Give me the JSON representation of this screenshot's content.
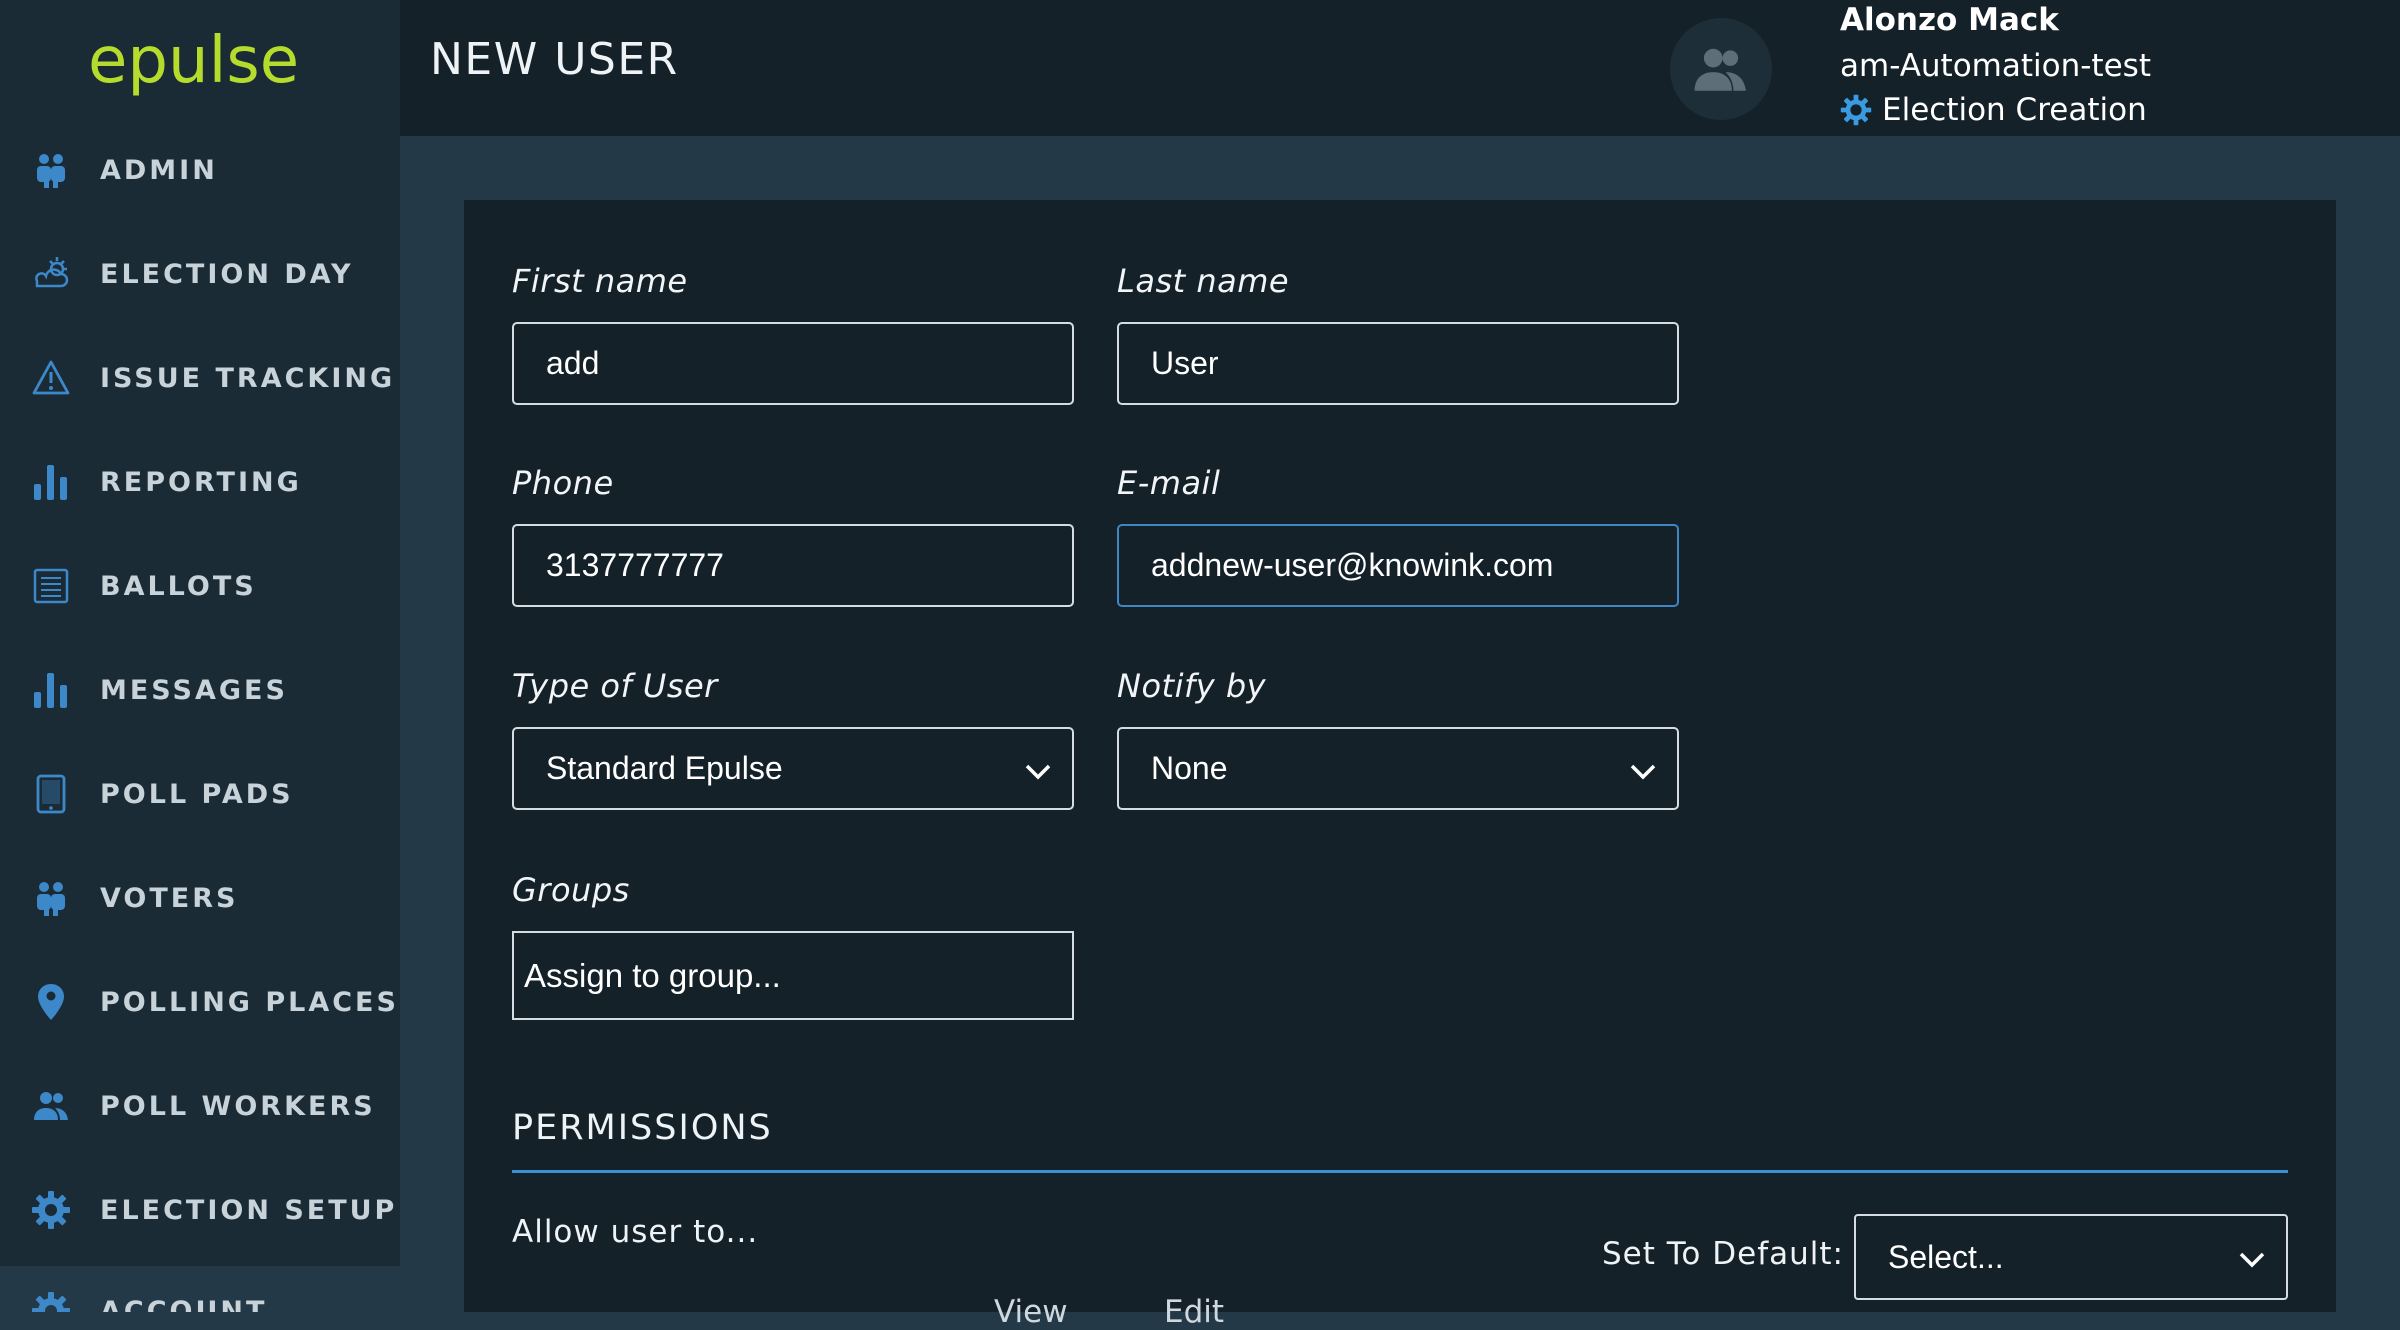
{
  "brand": {
    "logo_text": "epulse",
    "logo_color": "#b5dc2c"
  },
  "sidebar": {
    "items": [
      {
        "label": "ADMIN",
        "icon": "users-icon"
      },
      {
        "label": "ELECTION DAY",
        "icon": "cloud-sun-icon"
      },
      {
        "label": "ISSUE TRACKING",
        "icon": "warning-icon"
      },
      {
        "label": "REPORTING",
        "icon": "bar-chart-icon"
      },
      {
        "label": "BALLOTS",
        "icon": "ballot-icon"
      },
      {
        "label": "MESSAGES",
        "icon": "bar-chart-icon"
      },
      {
        "label": "POLL PADS",
        "icon": "tablet-icon"
      },
      {
        "label": "VOTERS",
        "icon": "users-icon"
      },
      {
        "label": "POLLING PLACES",
        "icon": "map-pin-icon"
      },
      {
        "label": "POLL WORKERS",
        "icon": "people-icon"
      },
      {
        "label": "ELECTION SETUP",
        "icon": "gear-icon"
      },
      {
        "label": "ACCOUNT",
        "icon": "gear-icon"
      }
    ]
  },
  "header": {
    "title": "NEW USER",
    "user_name": "Alonzo Mack",
    "user_org": "am-Automation-test",
    "user_role": "Election Creation",
    "avatar_icon": "people-icon"
  },
  "form": {
    "first_name": {
      "label": "First name",
      "value": "add"
    },
    "last_name": {
      "label": "Last name",
      "value": "User"
    },
    "phone": {
      "label": "Phone",
      "value": "3137777777"
    },
    "email": {
      "label": "E-mail",
      "value": "addnew-user@knowink.com"
    },
    "user_type": {
      "label": "Type of User",
      "value": "Standard Epulse"
    },
    "notify_by": {
      "label": "Notify by",
      "value": "None"
    },
    "groups": {
      "label": "Groups",
      "placeholder": "Assign to group..."
    }
  },
  "permissions": {
    "title": "PERMISSIONS",
    "allow_text": "Allow user to...",
    "default_label": "Set To Default:",
    "default_value": "Select...",
    "col_view": "View",
    "col_edit": "Edit"
  },
  "colors": {
    "sidebar_bg": "#1a2b36",
    "header_bg": "#152129",
    "page_bg": "#243947",
    "icon_blue": "#3d88c9",
    "accent_rule": "#3a8fd2",
    "focus_border": "#3f86c8"
  }
}
